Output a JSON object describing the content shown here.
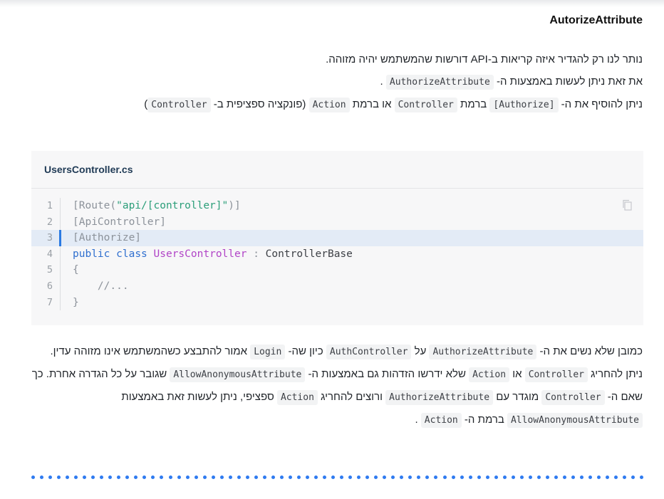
{
  "heading": "AutorizeAttribute",
  "intro": [
    [
      {
        "t": "נותר לנו רק להגדיר איזה קריאות ב-API דורשות שהמשתמש יהיה מזוהה."
      }
    ],
    [
      {
        "t": "את זאת ניתן לעשות באמצעות ה- "
      },
      {
        "c": "AuthorizeAttribute"
      },
      {
        "t": " ."
      }
    ],
    [
      {
        "t": "ניתן להוסיף את ה- "
      },
      {
        "c": "[Authorize]"
      },
      {
        "t": " ברמת "
      },
      {
        "c": "Controller"
      },
      {
        "t": " או ברמת "
      },
      {
        "c": "Action"
      },
      {
        "t": " (פונקציה ספציפית ב- "
      },
      {
        "c": "Controller"
      },
      {
        "t": ")"
      }
    ]
  ],
  "code_block": {
    "filename": "UsersController.cs",
    "highlighted_line": 3,
    "lines": [
      {
        "n": "1",
        "tokens": [
          {
            "s": "[Route(",
            "k": "plain2"
          },
          {
            "s": "\"api/[controller]\"",
            "k": "str"
          },
          {
            "s": ")]",
            "k": "plain2"
          }
        ]
      },
      {
        "n": "2",
        "tokens": [
          {
            "s": "[ApiController]",
            "k": "plain2"
          }
        ]
      },
      {
        "n": "3",
        "tokens": [
          {
            "s": "[Authorize]",
            "k": "plain2"
          }
        ]
      },
      {
        "n": "4",
        "tokens": [
          {
            "s": "public",
            "k": "kw"
          },
          {
            "s": " ",
            "k": "plain"
          },
          {
            "s": "class",
            "k": "kw"
          },
          {
            "s": " ",
            "k": "plain"
          },
          {
            "s": "UsersController",
            "k": "cls"
          },
          {
            "s": " : ",
            "k": "dim"
          },
          {
            "s": "ControllerBase",
            "k": "plain"
          }
        ]
      },
      {
        "n": "5",
        "tokens": [
          {
            "s": "{",
            "k": "dim"
          }
        ]
      },
      {
        "n": "6",
        "tokens": [
          {
            "s": "    //...",
            "k": "dim"
          }
        ]
      },
      {
        "n": "7",
        "tokens": [
          {
            "s": "}",
            "k": "dim"
          }
        ]
      }
    ],
    "copy_icon": "copy-icon"
  },
  "outro": [
    [
      {
        "t": "כמובן שלא נשים את ה- "
      },
      {
        "c": "AuthorizeAttribute"
      },
      {
        "t": " על "
      },
      {
        "c": "AuthController"
      },
      {
        "t": " כיון שה- "
      },
      {
        "c": "Login"
      },
      {
        "t": " אמור להתבצע כשהמשתמש אינו מזוהה עדין."
      }
    ],
    [
      {
        "t": "ניתן להחריג "
      },
      {
        "c": "Controller"
      },
      {
        "t": " או "
      },
      {
        "c": "Action"
      },
      {
        "t": " שלא ידרשו הזדהות גם באמצעות ה- "
      },
      {
        "c": "AllowAnonymousAttribute"
      },
      {
        "t": " שגובר על כל הגדרה אחרת. כך שאם ה- "
      },
      {
        "c": "Controller"
      },
      {
        "t": " מוגדר עם "
      },
      {
        "c": "AuthorizeAttribute"
      },
      {
        "t": " ורוצים להחריג "
      },
      {
        "c": "Action"
      },
      {
        "t": " ספציפי, ניתן לעשות זאת באמצעות "
      },
      {
        "c": "AllowAnonymousAttribute"
      },
      {
        "t": " ברמת ה- "
      },
      {
        "c": "Action"
      },
      {
        "t": " ."
      }
    ]
  ],
  "colors": {
    "accent": "#2f7bf0",
    "highlight": "#e3ebf6"
  }
}
